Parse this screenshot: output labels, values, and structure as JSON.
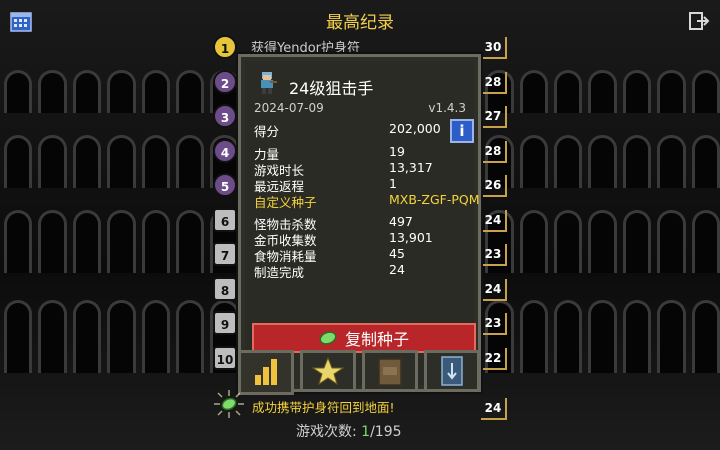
{
  "header": {
    "title": "最高纪录",
    "left_icon": "calendar-icon",
    "right_icon": "exit-icon"
  },
  "rankings": [
    {
      "rank": "1",
      "style": "gold",
      "text": "获得Yendor护身符",
      "depth": "30"
    },
    {
      "rank": "2",
      "style": "purple",
      "text": "",
      "depth": "28"
    },
    {
      "rank": "3",
      "style": "purple",
      "text": "",
      "depth": "27"
    },
    {
      "rank": "4",
      "style": "purple",
      "text": "",
      "depth": "28"
    },
    {
      "rank": "5",
      "style": "purple",
      "text": "",
      "depth": "26"
    },
    {
      "rank": "6",
      "style": "grey",
      "text": "",
      "depth": "24"
    },
    {
      "rank": "7",
      "style": "grey",
      "text": "",
      "depth": "23"
    },
    {
      "rank": "8",
      "style": "grey",
      "text": "",
      "depth": "24"
    },
    {
      "rank": "9",
      "style": "grey",
      "text": "",
      "depth": "23"
    },
    {
      "rank": "10",
      "style": "grey",
      "text": "",
      "depth": "22"
    }
  ],
  "record": {
    "hero_title": "24级狙击手",
    "date": "2024-07-09",
    "version": "v1.4.3",
    "score_label": "得分",
    "score_value": "202,000",
    "info_icon": "i",
    "strength_label": "力量",
    "strength_value": "19",
    "duration_label": "游戏时长",
    "duration_value": "13,317",
    "return_label": "最远返程",
    "return_value": "1",
    "seed_label": "自定义种子",
    "seed_value": "MXB-ZGF-PQM",
    "kills_label": "怪物击杀数",
    "kills_value": "497",
    "gold_label": "金币收集数",
    "gold_value": "13,901",
    "food_label": "食物消耗量",
    "food_value": "45",
    "crafted_label": "制造完成",
    "crafted_value": "24",
    "copy_seed_label": "复制种子"
  },
  "tabs": [
    "stats-icon",
    "star-icon",
    "backpack-icon",
    "journal-icon"
  ],
  "summary": {
    "win_text": "成功携带护身符回到地面!",
    "games_label": "游戏次数:",
    "games_current": "1",
    "games_total": "/195"
  },
  "colors": {
    "accent": "#f3d04b",
    "copy_button": "#b8262a",
    "info_button": "#2d5dc7",
    "highlight_green": "#7ddc6a"
  }
}
